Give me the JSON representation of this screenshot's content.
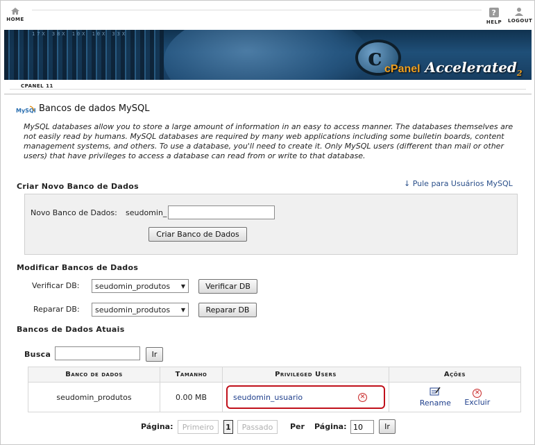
{
  "nav": {
    "home_label": "HOME",
    "help_label": "HELP",
    "logout_label": "LOGOUT"
  },
  "banner": {
    "ticker": "17X   38X   10X   10X   33X",
    "brand_cp": "cPanel",
    "brand_text": " Accelerated",
    "brand_version": "2"
  },
  "breadcrumb": {
    "tab": "CPANEL 11"
  },
  "page": {
    "icon_label": "MySQL",
    "title": "Bancos de dados MySQL",
    "intro": "MySQL databases allow you to store a large amount of information in an easy to access manner. The databases themselves are not easily read by humans. MySQL databases are required by many web applications including some bulletin boards, content management systems, and others. To use a database, you'll need to create it. Only MySQL users (different than mail or other users) that have privileges to access a database can read from or write to that database."
  },
  "create": {
    "heading": "Criar Novo Banco de Dados",
    "jump_link": "↓ Pule para Usuários MySQL",
    "label": "Novo Banco de Dados:",
    "prefix": "seudomin_",
    "input_value": "",
    "button": "Criar Banco de Dados"
  },
  "modify": {
    "heading": "Modificar Bancos de Dados",
    "check_label": "Verificar DB:",
    "check_selected": "seudomin_produtos",
    "check_button": "Verificar DB",
    "repair_label": "Reparar DB:",
    "repair_selected": "seudomin_produtos",
    "repair_button": "Reparar DB"
  },
  "current": {
    "heading": "Bancos de Dados Atuais",
    "search_label": "Busca",
    "search_value": "",
    "search_button": "Ir",
    "columns": [
      "Banco de dados",
      "Tamanho",
      "Privileged Users",
      "Ações"
    ],
    "rows": [
      {
        "database": "seudomin_produtos",
        "size": "0.00 MB",
        "user": "seudomin_usuario",
        "rename": "Rename",
        "delete": "Excluir"
      }
    ]
  },
  "pager": {
    "page_label": "Página:",
    "first": "Primeiro",
    "current": "1",
    "last": "Passado",
    "per_label": "Per",
    "per_page_label": "Página:",
    "per_page_value": "10",
    "go_button": "Ir"
  },
  "colors": {
    "highlight": "#c0101a",
    "link": "#1f3f8c",
    "brand_orange": "#f0a020"
  }
}
